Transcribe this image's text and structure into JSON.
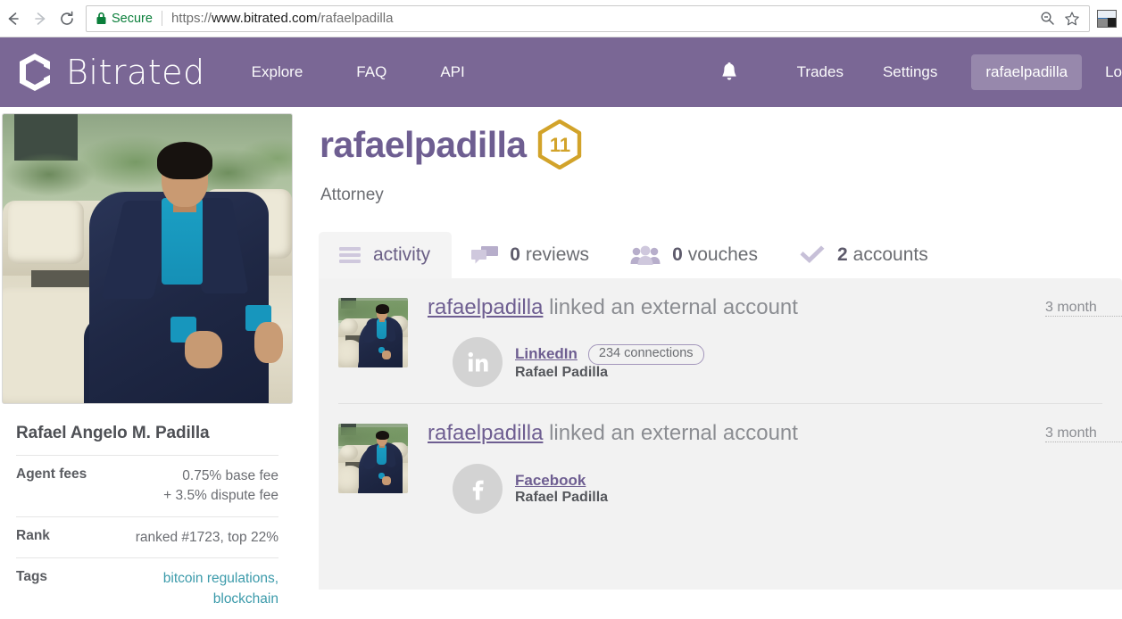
{
  "browser": {
    "back_icon": "back-arrow-icon",
    "forward_icon": "forward-arrow-icon",
    "reload_icon": "reload-icon",
    "security_label": "Secure",
    "url_scheme": "https://",
    "url_host": "www.bitrated.com",
    "url_path": "/rafaelpadilla",
    "url_full": "https://www.bitrated.com/rafaelpadilla",
    "zoom_icon": "zoom-out-icon",
    "bookmark_icon": "star-icon",
    "extension_icon": "extension-icon"
  },
  "navbar": {
    "logo_icon": "bitrated-logo-icon",
    "brand": "Bitrated",
    "links": [
      {
        "label": "Explore"
      },
      {
        "label": "FAQ"
      },
      {
        "label": "API"
      }
    ],
    "bell_icon": "notification-bell-icon",
    "right_links": [
      {
        "label": "Trades"
      },
      {
        "label": "Settings"
      }
    ],
    "user_button": "rafaelpadilla",
    "logout": "Lo",
    "bg_color": "#7a6795",
    "user_button_bg": "rgba(255,255,255,0.22)"
  },
  "profile": {
    "username": "rafaelpadilla",
    "badge_number": "11",
    "badge_color": "#d2a32a",
    "subtitle": "Attorney",
    "avatar_alt": "rafaelpadilla profile photo",
    "full_name": "Rafael Angelo M. Padilla",
    "username_color": "#6e5e91",
    "info": [
      {
        "label": "Agent fees",
        "values": [
          "0.75% base fee",
          "+ 3.5% dispute fee"
        ],
        "is_link": false
      },
      {
        "label": "Rank",
        "values": [
          "ranked #1723, top 22%"
        ],
        "is_link": false
      },
      {
        "label": "Tags",
        "values": [
          "bitcoin regulations, blockchain"
        ],
        "is_link": true,
        "link_color": "#3b9aaa"
      }
    ]
  },
  "tabs": [
    {
      "id": "activity",
      "icon": "hamburger-list-icon",
      "count": "",
      "label": "activity",
      "active": true
    },
    {
      "id": "reviews",
      "icon": "speech-bubbles-icon",
      "count": "0",
      "label": "reviews",
      "active": false
    },
    {
      "id": "vouches",
      "icon": "people-group-icon",
      "count": "0",
      "label": "vouches",
      "active": false
    },
    {
      "id": "accounts",
      "icon": "checkmark-icon",
      "count": "2",
      "label": "accounts",
      "active": false
    }
  ],
  "feed": [
    {
      "actor": "rafaelpadilla",
      "action": "linked an external account",
      "time": "3 month",
      "thumb_alt": "rafaelpadilla avatar thumbnail",
      "account": {
        "provider_icon": "linkedin-icon",
        "provider": "LinkedIn",
        "badge": "234 connections",
        "real_name": "Rafael Padilla"
      }
    },
    {
      "actor": "rafaelpadilla",
      "action": "linked an external account",
      "time": "3 month",
      "thumb_alt": "rafaelpadilla avatar thumbnail",
      "account": {
        "provider_icon": "facebook-icon",
        "provider": "Facebook",
        "badge": "",
        "real_name": "Rafael Padilla"
      }
    }
  ]
}
